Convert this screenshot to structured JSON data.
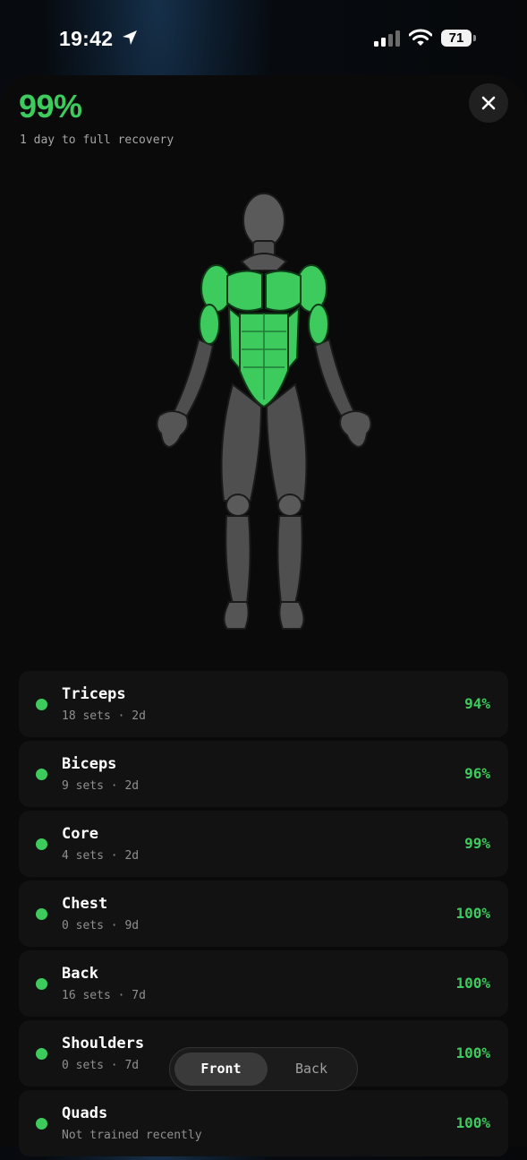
{
  "status_bar": {
    "time": "19:42",
    "battery": "71"
  },
  "recovery": {
    "percent": "99%",
    "subtitle": "1 day to full recovery"
  },
  "muscles": [
    {
      "name": "Triceps",
      "meta": "18 sets · 2d",
      "value": "94%"
    },
    {
      "name": "Biceps",
      "meta": "9 sets · 2d",
      "value": "96%"
    },
    {
      "name": "Core",
      "meta": "4 sets · 2d",
      "value": "99%"
    },
    {
      "name": "Chest",
      "meta": "0 sets · 9d",
      "value": "100%"
    },
    {
      "name": "Back",
      "meta": "16 sets · 7d",
      "value": "100%"
    },
    {
      "name": "Shoulders",
      "meta": "0 sets · 7d",
      "value": "100%"
    },
    {
      "name": "Quads",
      "meta": "Not trained recently",
      "value": "100%"
    }
  ],
  "toggle": {
    "front": "Front",
    "back": "Back"
  },
  "colors": {
    "accent": "#3ccb5c",
    "muscle_gray": "#5a5a5a",
    "sheet_bg": "#0a0a0a",
    "row_bg": "#121212"
  },
  "icons": [
    "location-arrow-icon",
    "cellular-signal-icon",
    "wifi-icon",
    "battery-icon",
    "close-icon"
  ]
}
